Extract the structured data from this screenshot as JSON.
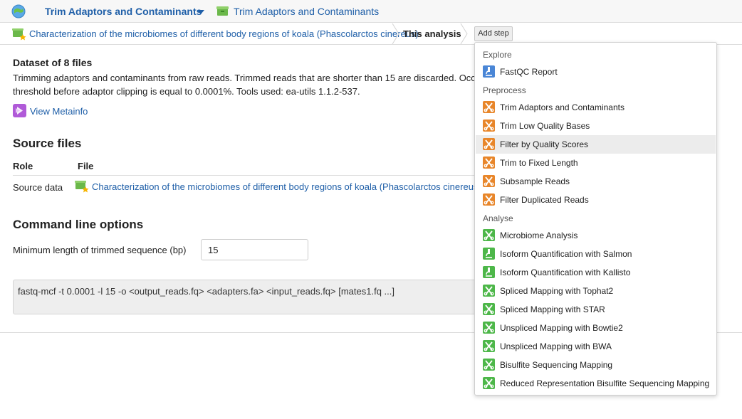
{
  "topbar": {
    "app_switch_label": "Trim Adaptors and Contaminants",
    "app_link_label": "Trim Adaptors and Contaminants"
  },
  "breadcrumb": {
    "project_label": "Characterization of the microbiomes of different body regions of koala (Phascolarctos cinereus)",
    "current_label": "This analysis",
    "add_step_label": "Add step"
  },
  "main": {
    "dataset_title": "Dataset of 8 files",
    "description": "Trimming adaptors and contaminants from raw reads. Trimmed reads that are shorter than 15 are discarded. Occurrence threshold before adaptor clipping is equal to 0.0001%. Tools used: ea-utils 1.1.2-537.",
    "metainfo_label": "View Metainfo",
    "source_files": {
      "heading": "Source files",
      "col_role": "Role",
      "col_file": "File",
      "row_role": "Source data",
      "row_file": "Characterization of the microbiomes of different body regions of koala (Phascolarctos cinereus)"
    },
    "command_line": {
      "heading": "Command line options",
      "min_length_label": "Minimum length of trimmed sequence (bp)",
      "min_length_value": "15",
      "command": "fastq-mcf -t 0.0001 -l 15 -o <output_reads.fq> <adapters.fa> <input_reads.fq> [mates1.fq ...]"
    }
  },
  "dropdown": {
    "sections": [
      {
        "header": "Explore",
        "items": [
          {
            "label": "FastQC Report",
            "icon": "microscope-icon",
            "color": "blue"
          }
        ]
      },
      {
        "header": "Preprocess",
        "items": [
          {
            "label": "Trim Adaptors and Contaminants",
            "icon": "scissors-icon",
            "color": "orange"
          },
          {
            "label": "Trim Low Quality Bases",
            "icon": "scissors-icon",
            "color": "orange"
          },
          {
            "label": "Filter by Quality Scores",
            "icon": "scissors-icon",
            "color": "orange",
            "hover": true
          },
          {
            "label": "Trim to Fixed Length",
            "icon": "scissors-icon",
            "color": "orange"
          },
          {
            "label": "Subsample Reads",
            "icon": "scissors-icon",
            "color": "orange"
          },
          {
            "label": "Filter Duplicated Reads",
            "icon": "scissors-icon",
            "color": "orange"
          }
        ]
      },
      {
        "header": "Analyse",
        "items": [
          {
            "label": "Microbiome Analysis",
            "icon": "scissors-icon",
            "color": "green"
          },
          {
            "label": "Isoform Quantification with Salmon",
            "icon": "microscope-icon",
            "color": "green"
          },
          {
            "label": "Isoform Quantification with Kallisto",
            "icon": "microscope-icon",
            "color": "green"
          },
          {
            "label": "Spliced Mapping with Tophat2",
            "icon": "scissors-icon",
            "color": "green"
          },
          {
            "label": "Spliced Mapping with STAR",
            "icon": "scissors-icon",
            "color": "green"
          },
          {
            "label": "Unspliced Mapping with Bowtie2",
            "icon": "scissors-icon",
            "color": "green"
          },
          {
            "label": "Unspliced Mapping with BWA",
            "icon": "scissors-icon",
            "color": "green"
          },
          {
            "label": "Bisulfite Sequencing Mapping",
            "icon": "scissors-icon",
            "color": "green"
          },
          {
            "label": "Reduced Representation Bisulfite Sequencing Mapping",
            "icon": "scissors-icon",
            "color": "green"
          }
        ]
      }
    ]
  },
  "colors": {
    "link": "#1f5fa8",
    "orange": "#e8862a",
    "green": "#4db749",
    "blue": "#4a86d6"
  }
}
